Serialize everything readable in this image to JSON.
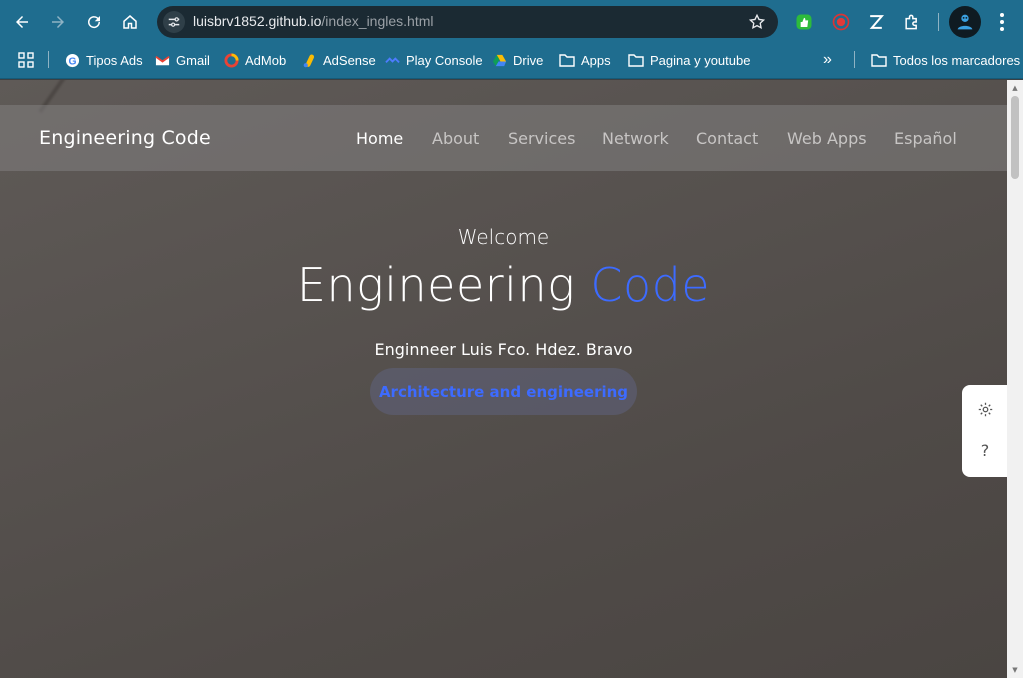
{
  "browser": {
    "url_host": "luisbrv1852.github.io",
    "url_path": "/index_ingles.html",
    "bookmarks": [
      {
        "label": "Tipos Ads",
        "icon": "google-icon"
      },
      {
        "label": "Gmail",
        "icon": "gmail-icon"
      },
      {
        "label": "AdMob",
        "icon": "admob-icon"
      },
      {
        "label": "AdSense",
        "icon": "adsense-icon"
      },
      {
        "label": "Play Console",
        "icon": "play-console-icon"
      },
      {
        "label": "Drive",
        "icon": "drive-icon"
      },
      {
        "label": "Apps",
        "icon": "folder-icon"
      },
      {
        "label": "Pagina y youtube",
        "icon": "folder-icon"
      }
    ],
    "all_bookmarks": "Todos los marcadores",
    "overflow_glyph": "»"
  },
  "site": {
    "brand": "Engineering Code",
    "nav": [
      "Home",
      "About",
      "Services",
      "Network",
      "Contact",
      "Web Apps",
      "Español"
    ],
    "active_nav": "Home",
    "welcome": "Welcome",
    "title_main": "Engineering ",
    "title_accent": "Code",
    "subtitle": "Enginneer Luis Fco. Hdez. Bravo",
    "cta": "Architecture and engineering",
    "help_glyph": "?"
  },
  "colors": {
    "accent": "#3d6bff",
    "browser_bar": "#1f6d8f"
  }
}
